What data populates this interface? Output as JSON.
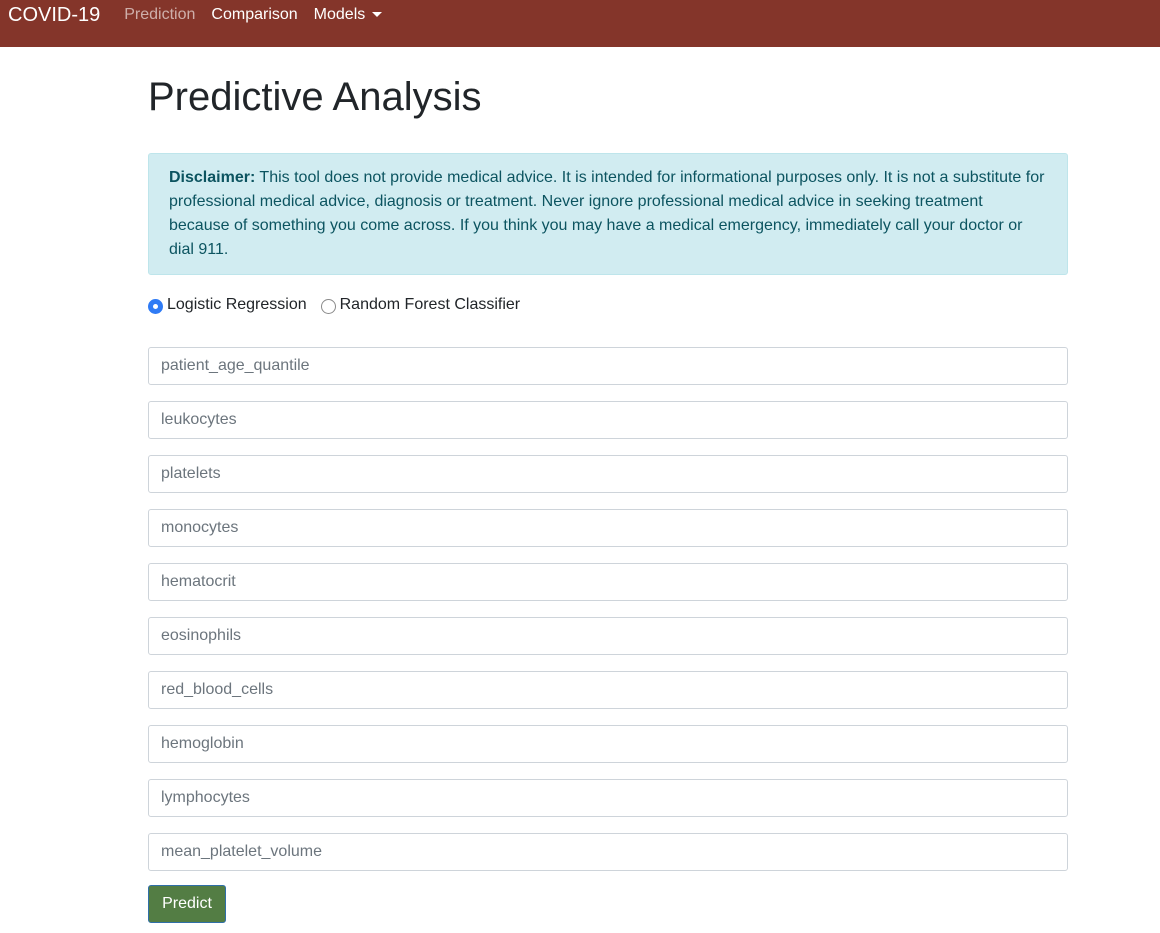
{
  "navbar": {
    "brand": "COVID-19",
    "links": [
      {
        "label": "Prediction",
        "active": true
      },
      {
        "label": "Comparison",
        "active": false
      },
      {
        "label": "Models",
        "dropdown": true
      }
    ],
    "color": "#84352a"
  },
  "page": {
    "title": "Predictive Analysis"
  },
  "alert": {
    "strong": "Disclaimer:",
    "text": " This tool does not provide medical advice. It is intended for informational purposes only. It is not a substitute for professional medical advice, diagnosis or treatment. Never ignore professional medical advice in seeking treatment because of something you come across. If you think you may have a medical emergency, immediately call your doctor or dial 911."
  },
  "model_options": [
    {
      "label": "Logistic Regression",
      "checked": true
    },
    {
      "label": "Random Forest Classifier",
      "checked": false
    }
  ],
  "fields": [
    {
      "placeholder": "patient_age_quantile"
    },
    {
      "placeholder": "leukocytes"
    },
    {
      "placeholder": "platelets"
    },
    {
      "placeholder": "monocytes"
    },
    {
      "placeholder": "hematocrit"
    },
    {
      "placeholder": "eosinophils"
    },
    {
      "placeholder": "red_blood_cells"
    },
    {
      "placeholder": "hemoglobin"
    },
    {
      "placeholder": "lymphocytes"
    },
    {
      "placeholder": "mean_platelet_volume"
    }
  ],
  "submit": {
    "label": "Predict",
    "color": "#537d44"
  }
}
